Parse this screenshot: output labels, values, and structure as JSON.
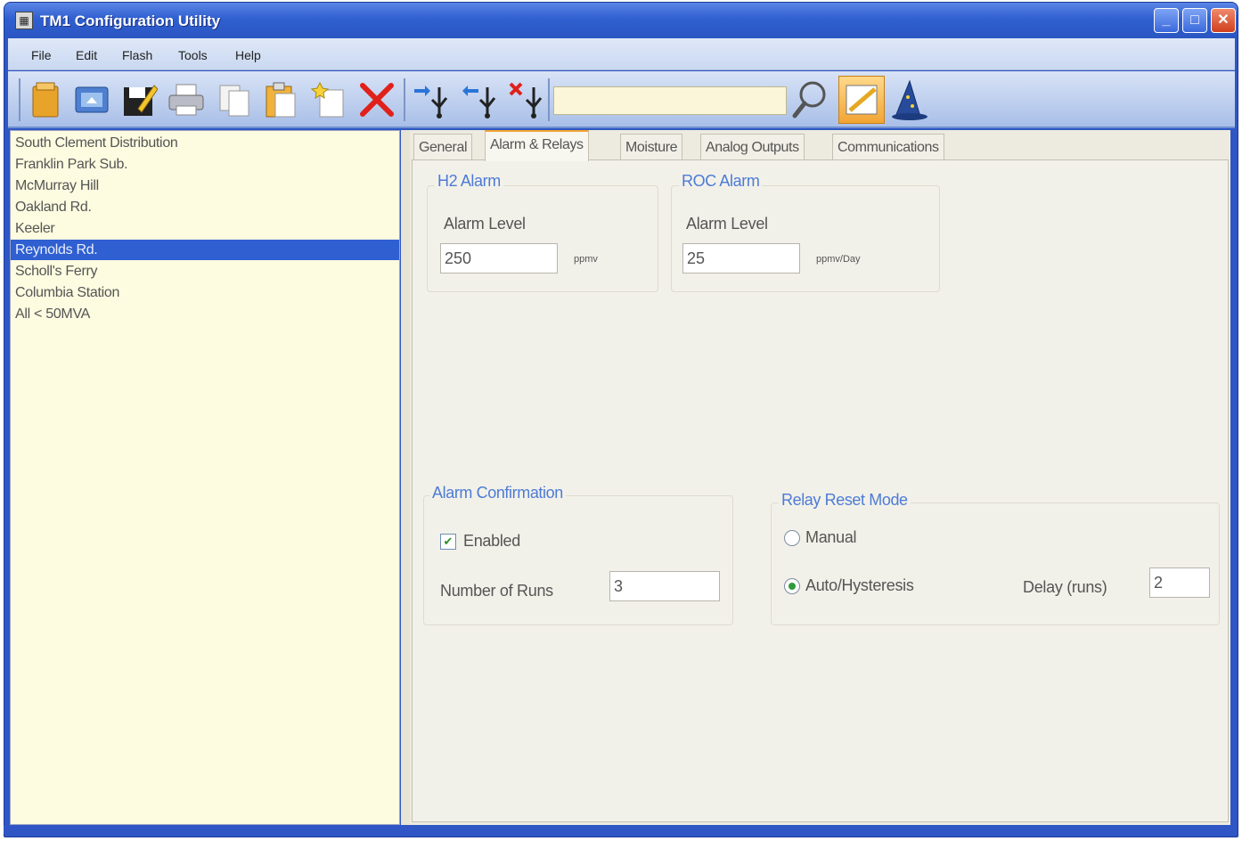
{
  "window": {
    "title": "TM1 Configuration Utility",
    "title_icon": "app-icon"
  },
  "title_buttons": {
    "minimize": "minimize-icon",
    "maximize": "maximize-icon",
    "close": "close-icon"
  },
  "menu": [
    "File",
    "Edit",
    "Flash",
    "Tools",
    "Help"
  ],
  "toolbar": {
    "icons": [
      "open-file-icon",
      "network-icon",
      "save-icon",
      "print-icon",
      "copy-icon",
      "paste-icon",
      "new-item-icon",
      "delete-icon",
      "usb-send-icon",
      "usb-receive-icon",
      "usb-disconnect-icon",
      "search-icon",
      "edit-active-icon",
      "wizard-icon"
    ],
    "search_value": ""
  },
  "sites": [
    "South Clement Distribution",
    "Franklin Park Sub.",
    "McMurray Hill",
    "Oakland Rd.",
    "Keeler",
    "Reynolds Rd.",
    "Scholl's Ferry",
    "Columbia Station",
    "All < 50MVA"
  ],
  "selected_site_index": 5,
  "tabs": [
    "General",
    "Alarm & Relays",
    "Moisture",
    "Analog Outputs",
    "Communications"
  ],
  "active_tab": "Alarm & Relays",
  "h2_alarm": {
    "title": "H2 Alarm",
    "level_label": "Alarm Level",
    "value": "250",
    "unit": "ppmv"
  },
  "roc_alarm": {
    "title": "ROC Alarm",
    "level_label": "Alarm Level",
    "value": "25",
    "unit": "ppmv/Day"
  },
  "alarm_confirmation": {
    "title": "Alarm Confirmation",
    "enabled_label": "Enabled",
    "enabled": true,
    "runs_label": "Number of Runs",
    "runs_value": "3"
  },
  "relay_reset": {
    "title": "Relay Reset Mode",
    "manual_label": "Manual",
    "auto_label": "Auto/Hysteresis",
    "selected": "Auto/Hysteresis",
    "delay_label": "Delay (runs)",
    "delay_value": "2"
  }
}
